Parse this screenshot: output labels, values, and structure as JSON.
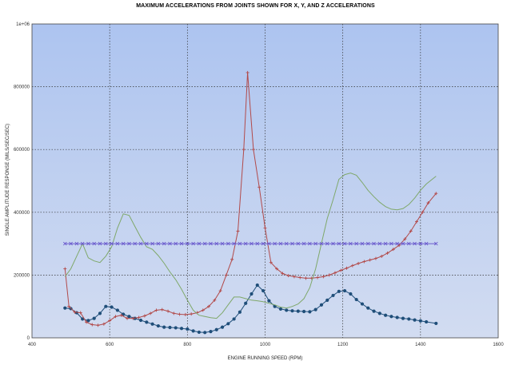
{
  "chart_data": {
    "type": "line",
    "title": "MAXIMUM ACCELERATIONS FROM JOINTS SHOWN FOR X, Y, AND Z ACCELERATIONS",
    "xlabel": "ENGINE RUNNING SPEED (RPM)",
    "ylabel": "SINGLE AMPLITUDE RESPONSE (MILS/SEC/SEC)",
    "xlim": [
      400,
      1600
    ],
    "ylim": [
      0,
      1000000
    ],
    "xticks": [
      "400",
      "600",
      "800",
      "1000",
      "1200",
      "1400",
      "1600"
    ],
    "yticks": [
      "0",
      "200000",
      "400000",
      "600000",
      "800000",
      "1e+06"
    ],
    "grid": true,
    "background_gradient": [
      "#d2dcf1",
      "#adc4f0"
    ],
    "series": [
      {
        "color": "#1f4e79",
        "marker": "dot",
        "x": [
          485,
          500,
          515,
          530,
          545,
          560,
          575,
          590,
          605,
          620,
          635,
          650,
          665,
          680,
          695,
          710,
          725,
          740,
          755,
          770,
          785,
          800,
          815,
          830,
          845,
          860,
          875,
          890,
          905,
          920,
          935,
          950,
          965,
          980,
          995,
          1010,
          1025,
          1040,
          1055,
          1070,
          1085,
          1100,
          1115,
          1130,
          1145,
          1160,
          1175,
          1190,
          1205,
          1220,
          1235,
          1250,
          1265,
          1280,
          1295,
          1310,
          1325,
          1340,
          1355,
          1370,
          1385,
          1400,
          1415,
          1440
        ],
        "y": [
          95000,
          93000,
          80000,
          60000,
          55000,
          62000,
          78000,
          100000,
          98000,
          88000,
          75000,
          68000,
          62000,
          56000,
          50000,
          44000,
          38000,
          34000,
          33000,
          32000,
          30000,
          28000,
          22000,
          18000,
          17000,
          20000,
          26000,
          34000,
          45000,
          60000,
          82000,
          110000,
          140000,
          168000,
          150000,
          118000,
          100000,
          92000,
          88000,
          86000,
          85000,
          84000,
          83000,
          90000,
          105000,
          120000,
          135000,
          148000,
          150000,
          140000,
          122000,
          108000,
          95000,
          85000,
          78000,
          72000,
          68000,
          65000,
          62000,
          60000,
          57000,
          54000,
          51000,
          46000
        ]
      },
      {
        "color": "#b24a4a",
        "marker": "plus",
        "x": [
          485,
          495,
          510,
          525,
          540,
          555,
          570,
          585,
          600,
          615,
          630,
          645,
          660,
          675,
          690,
          705,
          720,
          735,
          750,
          765,
          780,
          795,
          810,
          825,
          840,
          855,
          870,
          885,
          900,
          915,
          930,
          945,
          955,
          970,
          985,
          1000,
          1015,
          1030,
          1045,
          1060,
          1075,
          1090,
          1105,
          1120,
          1135,
          1150,
          1165,
          1180,
          1195,
          1210,
          1225,
          1240,
          1255,
          1270,
          1285,
          1300,
          1315,
          1330,
          1345,
          1360,
          1375,
          1390,
          1405,
          1420,
          1440
        ],
        "y": [
          220000,
          100000,
          82000,
          80000,
          50000,
          42000,
          40000,
          44000,
          55000,
          68000,
          72000,
          62000,
          62000,
          65000,
          70000,
          78000,
          88000,
          90000,
          85000,
          78000,
          75000,
          74000,
          76000,
          80000,
          88000,
          100000,
          120000,
          150000,
          200000,
          250000,
          340000,
          600000,
          845000,
          600000,
          480000,
          350000,
          240000,
          220000,
          205000,
          198000,
          195000,
          192000,
          190000,
          190000,
          192000,
          195000,
          200000,
          207000,
          215000,
          222000,
          230000,
          237000,
          243000,
          248000,
          253000,
          260000,
          270000,
          282000,
          295000,
          315000,
          340000,
          370000,
          400000,
          430000,
          460000
        ]
      },
      {
        "color": "#7fa86a",
        "marker": "none",
        "x": [
          485,
          500,
          515,
          530,
          545,
          560,
          575,
          590,
          605,
          620,
          635,
          650,
          665,
          680,
          695,
          710,
          725,
          740,
          755,
          770,
          785,
          800,
          815,
          830,
          845,
          860,
          875,
          890,
          905,
          920,
          935,
          950,
          965,
          980,
          995,
          1010,
          1025,
          1040,
          1055,
          1070,
          1085,
          1100,
          1115,
          1130,
          1145,
          1160,
          1175,
          1190,
          1205,
          1220,
          1235,
          1250,
          1265,
          1280,
          1295,
          1310,
          1325,
          1340,
          1355,
          1370,
          1385,
          1400,
          1415,
          1440
        ],
        "y": [
          195000,
          220000,
          260000,
          300000,
          255000,
          245000,
          240000,
          260000,
          290000,
          350000,
          395000,
          390000,
          355000,
          320000,
          290000,
          282000,
          262000,
          238000,
          210000,
          185000,
          155000,
          120000,
          88000,
          72000,
          68000,
          64000,
          62000,
          80000,
          105000,
          130000,
          130000,
          125000,
          120000,
          118000,
          115000,
          110000,
          105000,
          98000,
          95000,
          100000,
          108000,
          125000,
          160000,
          220000,
          300000,
          380000,
          440000,
          505000,
          520000,
          525000,
          518000,
          495000,
          470000,
          450000,
          432000,
          418000,
          410000,
          408000,
          412000,
          425000,
          445000,
          470000,
          490000,
          515000
        ]
      },
      {
        "color": "#6a5acd",
        "marker": "x",
        "x": [
          485,
          500,
          515,
          530,
          545,
          560,
          575,
          590,
          605,
          620,
          635,
          650,
          665,
          680,
          695,
          710,
          725,
          740,
          755,
          770,
          785,
          800,
          815,
          830,
          845,
          860,
          875,
          890,
          905,
          920,
          935,
          950,
          965,
          980,
          995,
          1010,
          1025,
          1040,
          1055,
          1070,
          1085,
          1100,
          1115,
          1130,
          1145,
          1160,
          1175,
          1190,
          1205,
          1220,
          1235,
          1250,
          1265,
          1280,
          1295,
          1310,
          1325,
          1340,
          1355,
          1370,
          1385,
          1400,
          1415,
          1440
        ],
        "y": [
          300000,
          300000,
          300000,
          300000,
          300000,
          300000,
          300000,
          300000,
          300000,
          300000,
          300000,
          300000,
          300000,
          300000,
          300000,
          300000,
          300000,
          300000,
          300000,
          300000,
          300000,
          300000,
          300000,
          300000,
          300000,
          300000,
          300000,
          300000,
          300000,
          300000,
          300000,
          300000,
          300000,
          300000,
          300000,
          300000,
          300000,
          300000,
          300000,
          300000,
          300000,
          300000,
          300000,
          300000,
          300000,
          300000,
          300000,
          300000,
          300000,
          300000,
          300000,
          300000,
          300000,
          300000,
          300000,
          300000,
          300000,
          300000,
          300000,
          300000,
          300000,
          300000,
          300000,
          300000
        ]
      }
    ]
  }
}
